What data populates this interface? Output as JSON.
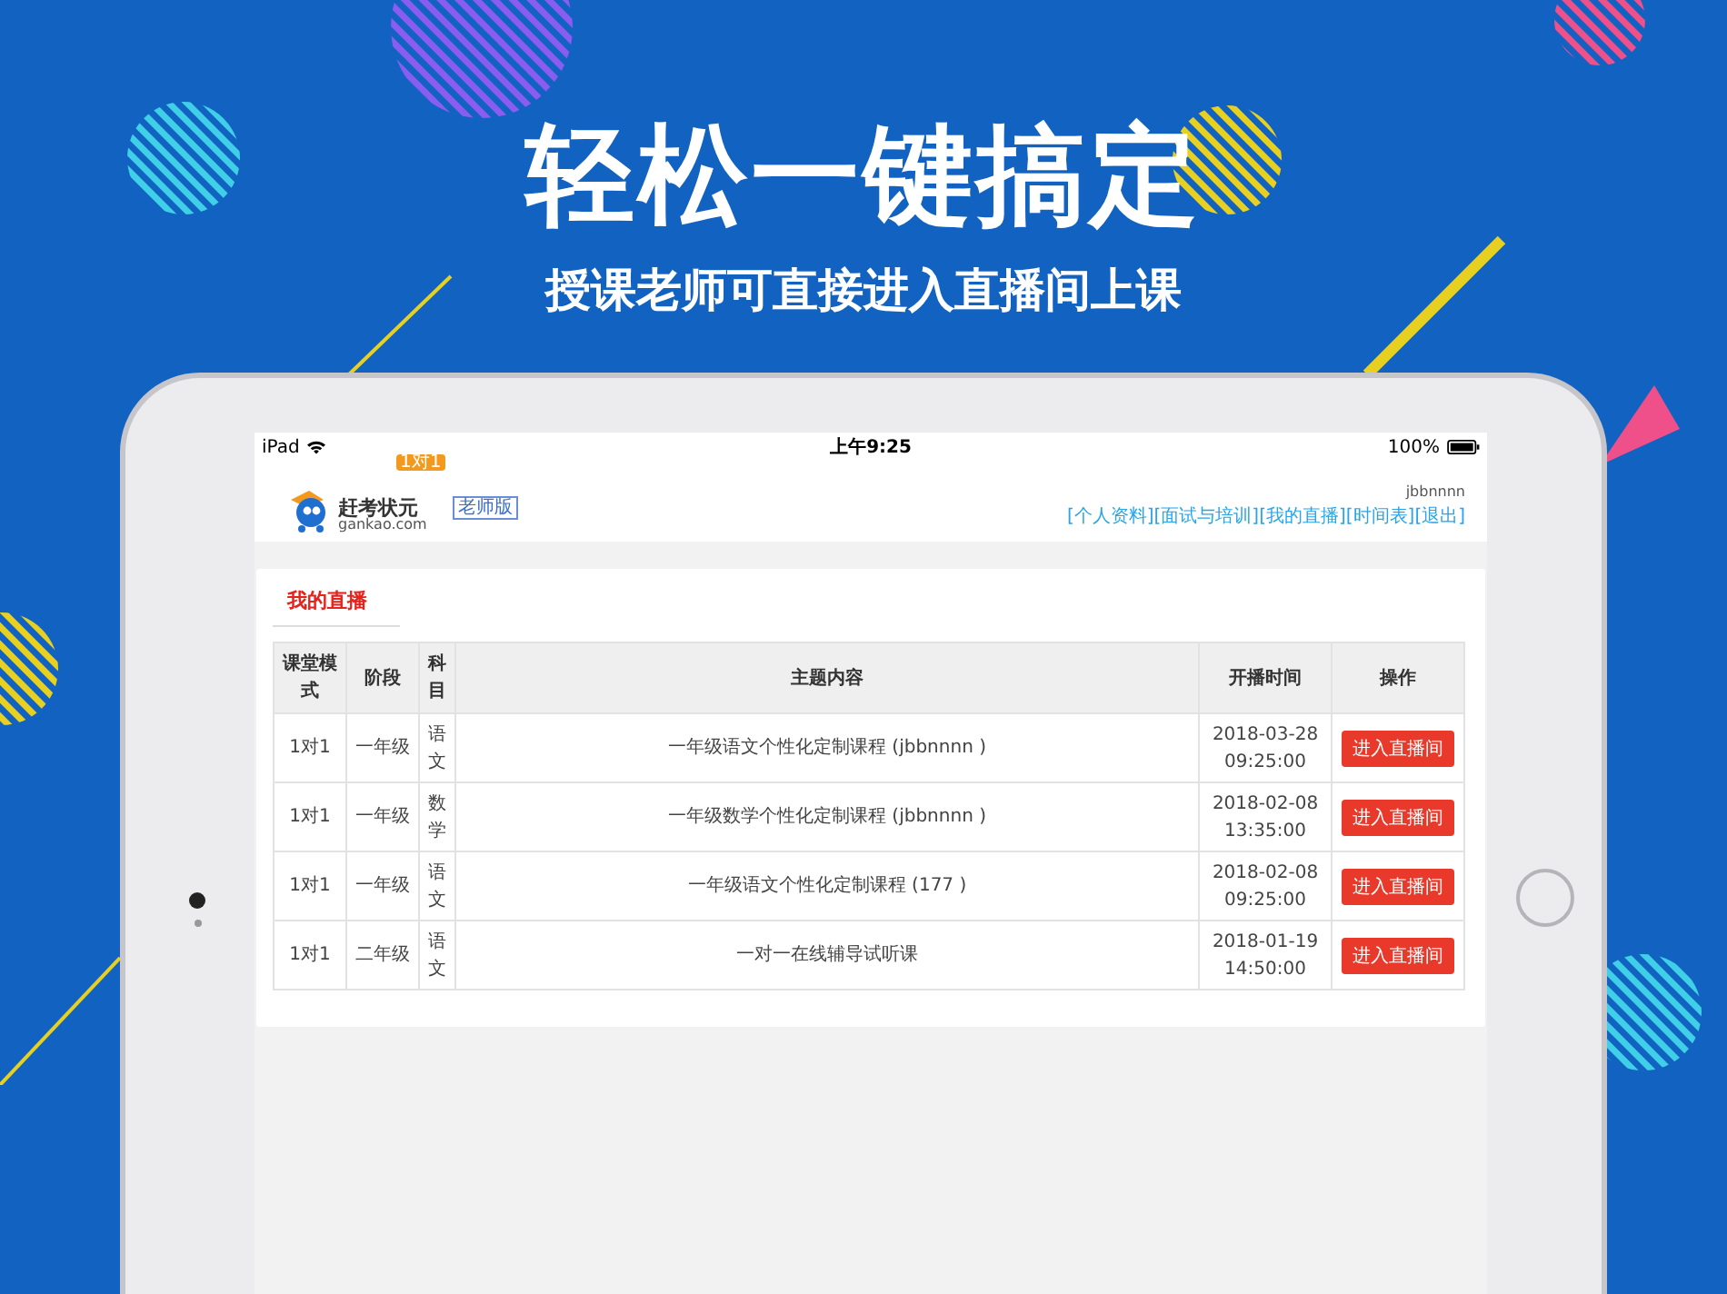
{
  "headline": "轻松一键搞定",
  "subtitle": "授课老师可直接进入直播间上课",
  "status_bar": {
    "device": "iPad",
    "time": "上午9:25",
    "battery": "100%"
  },
  "header": {
    "logo_text": "赶考状元",
    "logo_domain": "gankao.com",
    "logo_badge": "1对1",
    "role_badge": "老师版",
    "username": "jbbnnnn",
    "nav": [
      "[个人资料]",
      "[面试与培训]",
      "[我的直播]",
      "[时间表]",
      "[退出]"
    ]
  },
  "section_title": "我的直播",
  "table": {
    "columns": [
      "课堂模式",
      "阶段",
      "科目",
      "主题内容",
      "开播时间",
      "操作"
    ],
    "rows": [
      {
        "mode": "1对1",
        "stage": "一年级",
        "subject": "语文",
        "topic": "一年级语文个性化定制课程 (jbbnnnn )",
        "date": "2018-03-28",
        "time": "09:25:00",
        "action": "进入直播间"
      },
      {
        "mode": "1对1",
        "stage": "一年级",
        "subject": "数学",
        "topic": "一年级数学个性化定制课程 (jbbnnnn )",
        "date": "2018-02-08",
        "time": "13:35:00",
        "action": "进入直播间"
      },
      {
        "mode": "1对1",
        "stage": "一年级",
        "subject": "语文",
        "topic": "一年级语文个性化定制课程 (177 )",
        "date": "2018-02-08",
        "time": "09:25:00",
        "action": "进入直播间"
      },
      {
        "mode": "1对1",
        "stage": "二年级",
        "subject": "语文",
        "topic": "一对一在线辅导试听课",
        "date": "2018-01-19",
        "time": "14:50:00",
        "action": "进入直播间"
      }
    ]
  }
}
